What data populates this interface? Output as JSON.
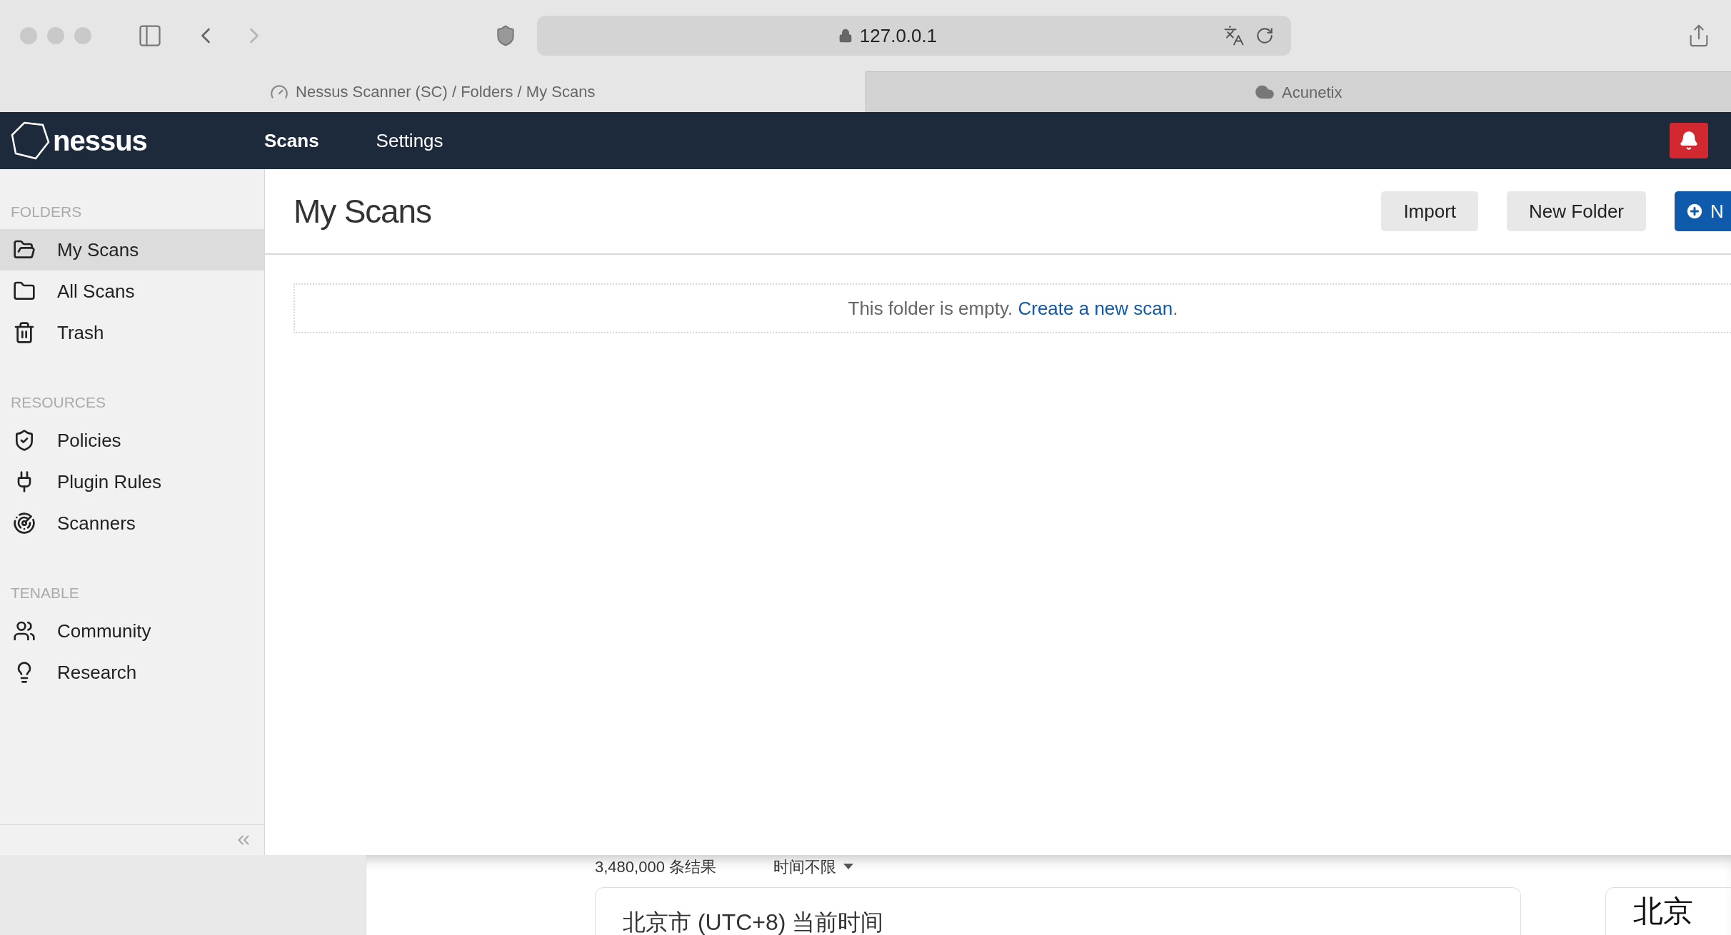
{
  "browser": {
    "address": "127.0.0.1",
    "tabs": [
      {
        "title": "Nessus Scanner (SC) / Folders / My Scans",
        "selected": true
      },
      {
        "title": "Acunetix",
        "selected": false
      }
    ]
  },
  "app": {
    "logo": "nessus",
    "nav": [
      {
        "label": "Scans",
        "selected": true
      },
      {
        "label": "Settings",
        "selected": false
      }
    ]
  },
  "sidebar": {
    "sections": [
      {
        "heading": "FOLDERS",
        "items": [
          {
            "label": "My Scans",
            "selected": true
          },
          {
            "label": "All Scans",
            "selected": false
          },
          {
            "label": "Trash",
            "selected": false
          }
        ]
      },
      {
        "heading": "RESOURCES",
        "items": [
          {
            "label": "Policies",
            "selected": false
          },
          {
            "label": "Plugin Rules",
            "selected": false
          },
          {
            "label": "Scanners",
            "selected": false
          }
        ]
      },
      {
        "heading": "TENABLE",
        "items": [
          {
            "label": "Community",
            "selected": false
          },
          {
            "label": "Research",
            "selected": false
          }
        ]
      }
    ]
  },
  "page": {
    "title": "My Scans",
    "buttons": [
      {
        "label": "Import",
        "kind": "secondary"
      },
      {
        "label": "New Folder",
        "kind": "secondary"
      },
      {
        "label": "N",
        "kind": "primary"
      }
    ],
    "empty_message": "This folder is empty. ",
    "empty_link": "Create a new scan",
    "empty_end": "."
  },
  "background_page": {
    "result_count": "3,480,000 条结果",
    "time_filter": "时间不限",
    "card_title": "北京市 (UTC+8) 当前时间",
    "side_card_title": "北京"
  }
}
